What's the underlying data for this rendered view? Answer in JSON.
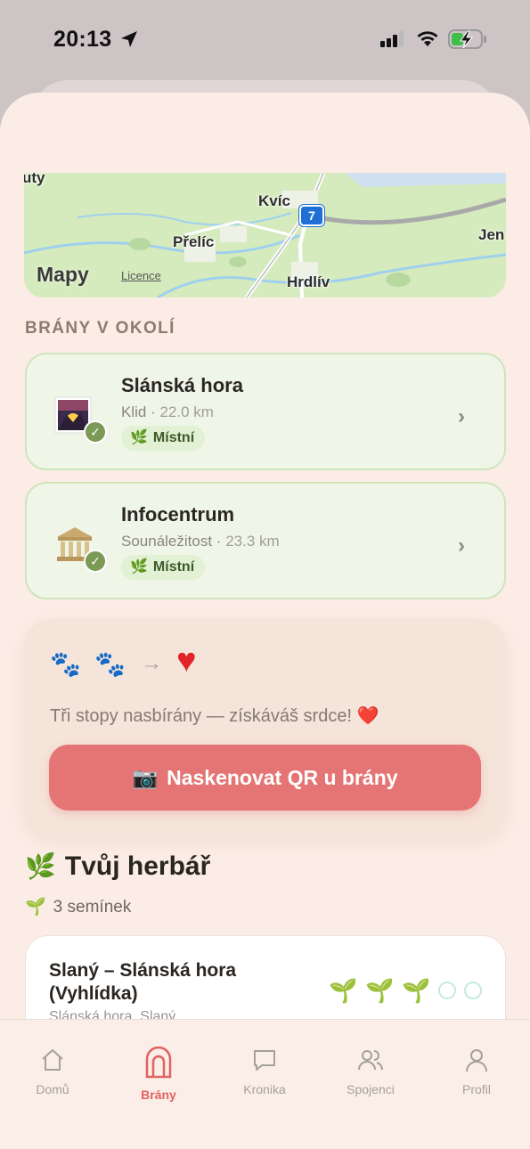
{
  "status_bar": {
    "time": "20:13"
  },
  "map": {
    "labels": [
      "Kvíc",
      "Přelíc",
      "Hrdlív",
      "Jen",
      "uty"
    ],
    "route_number": "7",
    "logo_text": "Mapy",
    "licence_label": "Licence"
  },
  "nearby": {
    "section_title": "BRÁNY V OKOLÍ",
    "gates": [
      {
        "name": "Slánská hora",
        "category": "Klid",
        "distance": "22.0 km",
        "tag": "Místní",
        "tag_icon": "leaf-icon",
        "icon": "sunset-image-icon"
      },
      {
        "name": "Infocentrum",
        "category": "Sounáležitost",
        "distance": "23.3 km",
        "tag": "Místní",
        "tag_icon": "leaf-icon",
        "icon": "classical-building-icon"
      }
    ]
  },
  "promo": {
    "progress_icons": [
      "paw-icon",
      "paw-icon",
      "arrow-icon",
      "heart-icon"
    ],
    "message": "Tři stopy nasbírány — získáváš srdce! ❤️",
    "button_label": "Naskenovat QR u brány"
  },
  "herbarium": {
    "title": "Tvůj herbář",
    "count_label": "3 semínek",
    "items": [
      {
        "title": "Slaný – Slánská hora (Vyhlídka)",
        "subtitle": "Slánská hora, Slaný",
        "seeds_collected": 3,
        "seeds_total": 5
      }
    ]
  },
  "tabbar": {
    "tabs": [
      {
        "label": "Domů",
        "icon": "home-icon",
        "active": false
      },
      {
        "label": "Brány",
        "icon": "gate-icon",
        "active": true
      },
      {
        "label": "Kronika",
        "icon": "chat-bubble-icon",
        "active": false
      },
      {
        "label": "Spojenci",
        "icon": "people-icon",
        "active": false
      },
      {
        "label": "Profil",
        "icon": "person-icon",
        "active": false
      }
    ]
  },
  "colors": {
    "accent": "#e26161",
    "button": "#e57574",
    "card_green": "#eff6e8",
    "background": "#fbede6"
  }
}
